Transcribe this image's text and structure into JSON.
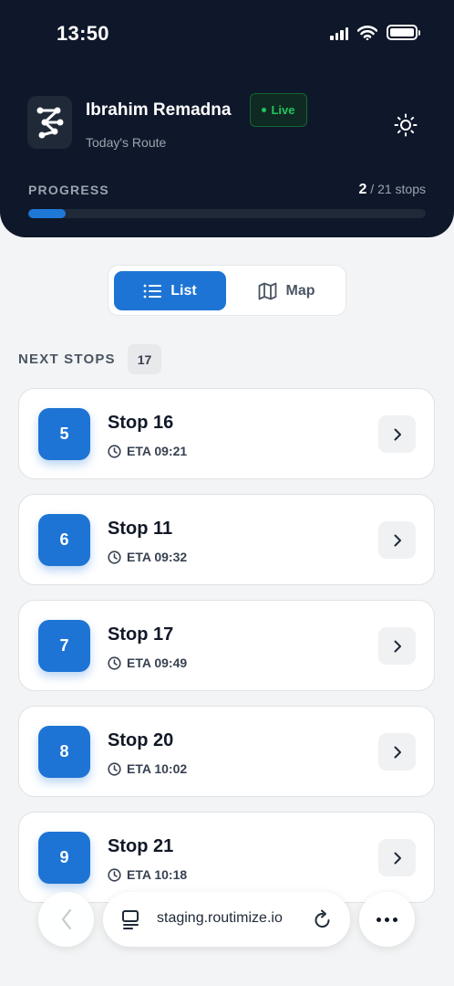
{
  "status_bar": {
    "time": "13:50"
  },
  "header": {
    "driver_name": "Ibrahim Remadna",
    "live_label": "Live",
    "subtitle": "Today's Route",
    "logo_icon": "route-network-icon",
    "theme_icon": "sun-icon"
  },
  "progress": {
    "label": "PROGRESS",
    "completed": "2",
    "total_text": "/ 21 stops",
    "fraction": 0.095
  },
  "view_toggle": {
    "list_label": "List",
    "map_label": "Map",
    "selected": "List"
  },
  "next_stops": {
    "label": "NEXT STOPS",
    "count": "17",
    "items": [
      {
        "number": "5",
        "title": "Stop 16",
        "eta": "ETA 09:21"
      },
      {
        "number": "6",
        "title": "Stop 11",
        "eta": "ETA 09:32"
      },
      {
        "number": "7",
        "title": "Stop 17",
        "eta": "ETA 09:49"
      },
      {
        "number": "8",
        "title": "Stop 20",
        "eta": "ETA 10:02"
      },
      {
        "number": "9",
        "title": "Stop 21",
        "eta": "ETA 10:18"
      }
    ]
  },
  "browser": {
    "url": "staging.routimize.io"
  },
  "colors": {
    "header_bg": "#0f172a",
    "accent": "#1d74d4",
    "live_green": "#22c55e",
    "page_bg": "#f3f4f5"
  }
}
